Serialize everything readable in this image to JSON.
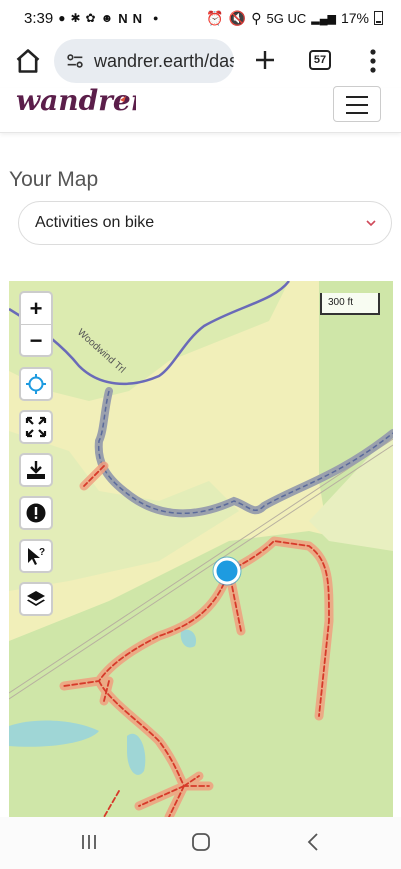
{
  "status_bar": {
    "time": "3:39",
    "left_icons": [
      "message-icon",
      "slack-icon",
      "chatgpt-icon",
      "reddit-icon",
      "n-icon",
      "n-icon",
      "dot-icon"
    ],
    "n1": "N",
    "n2": "N",
    "network": "5G UC",
    "battery": "17%"
  },
  "browser": {
    "url": "wandrer.earth/das",
    "tab_count": "57"
  },
  "header": {
    "logo_text": "wandrer",
    "brand_color": "#5b1e4a"
  },
  "page": {
    "title": "Your Map",
    "select_value": "Activities on bike"
  },
  "map": {
    "scale_label": "300 ft",
    "road_label": "Woodwind Trl",
    "controls": [
      "zoom-in",
      "zoom-out",
      "locate",
      "fullscreen",
      "download",
      "info",
      "query",
      "layers"
    ],
    "zoom_in_label": "+",
    "zoom_out_label": "−",
    "colors": {
      "untraveled": "#e0533a",
      "traveled_path": "#8a8fa0",
      "location": "#1e9be0",
      "forest": "#cfe6a8",
      "field": "#f1efb9",
      "water": "#9fd6d6"
    }
  }
}
